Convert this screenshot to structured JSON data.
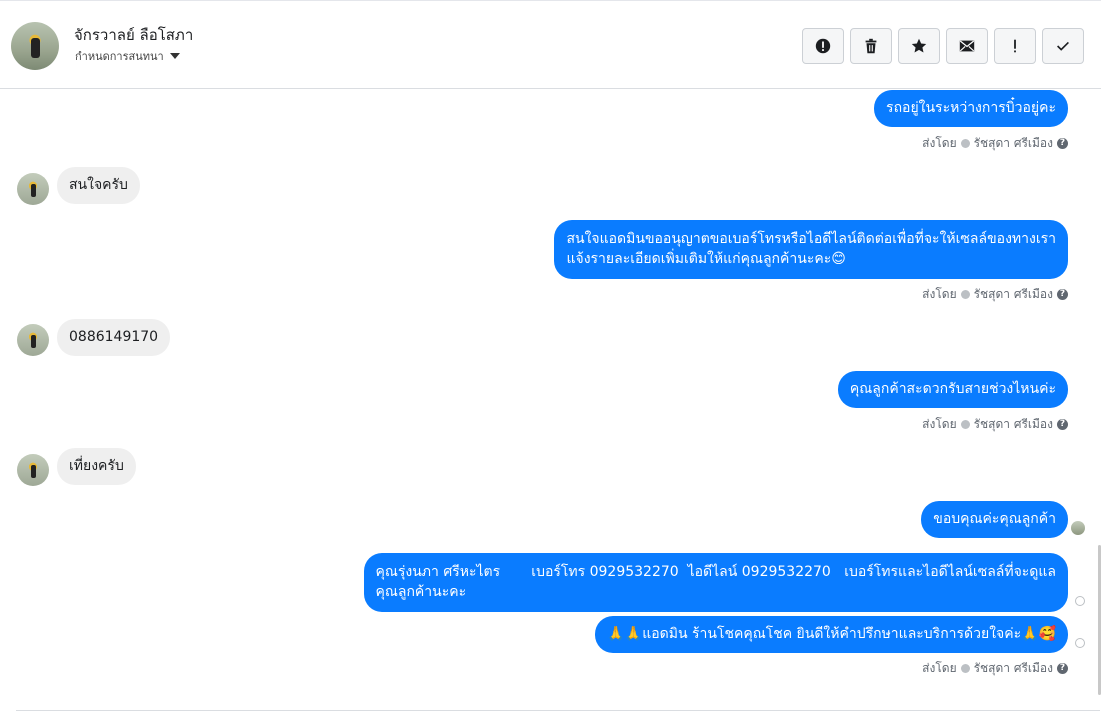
{
  "header": {
    "contact_name": "จักรวาลย์ ลือโสภา",
    "assign_label": "กำหนดการสนทนา"
  },
  "icons": [
    "alert-icon",
    "trash-icon",
    "star-icon",
    "mail-icon",
    "exclamation-icon",
    "check-icon"
  ],
  "messages": [
    {
      "text": "รถอยู่ในระหว่างการบิ๋วอยู่คะ",
      "dir": "out"
    },
    {
      "text": "สนใจครับ",
      "dir": "in"
    },
    {
      "text": "สนใจแอดมินขออนุญาตขอเบอร์โทรหรือไอดีไลน์ติดต่อเพื่อที่จะให้เซลล์ของทางเรา",
      "text2": "แจ้งรายละเอียดเพิ่มเติมให้แก่คุณลูกค้านะคะ😊",
      "dir": "out"
    },
    {
      "text": "0886149170",
      "dir": "in"
    },
    {
      "text": "คุณลูกค้าสะดวกรับสายช่วงไหนค่ะ",
      "dir": "out"
    },
    {
      "text": "เที่ยงครับ",
      "dir": "in"
    },
    {
      "text": "ขอบคุณค่ะคุณลูกค้า",
      "dir": "out"
    },
    {
      "text": "คุณรุ่งนภา ศรีหะไตร       เบอร์โทร 0929532270  ไอดีไลน์ 0929532270   เบอร์โทรและไอดีไลน์เซลล์ที่จะดูแล",
      "text2": "คุณลูกค้านะคะ",
      "dir": "out"
    },
    {
      "text": "🙏🙏แอดมิน ร้านโชคคุณโชค ยินดีให้คำปรึกษาและบริการด้วยใจค่ะ🙏🥰",
      "dir": "out"
    }
  ],
  "sent_by": {
    "prefix": "ส่งโดย",
    "agent": "รัชสุดา ศรีเมือง",
    "help": "?"
  },
  "colors": {
    "outgoing": "#0a7cff",
    "incoming": "#efefef"
  }
}
